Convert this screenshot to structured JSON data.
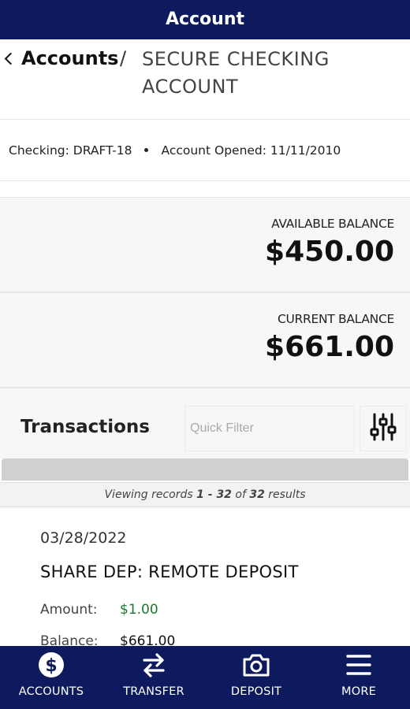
{
  "header": {
    "title": "Account"
  },
  "breadcrumb": {
    "back_label": "Accounts",
    "separator": "/",
    "current": "SECURE CHECKING ACCOUNT"
  },
  "account_info": {
    "checking": "Checking: DRAFT-18",
    "opened": "Account Opened: 11/11/2010"
  },
  "balances": {
    "available_label": "AVAILABLE BALANCE",
    "available_value": "$450.00",
    "current_label": "CURRENT BALANCE",
    "current_value": "$661.00"
  },
  "transactions": {
    "title": "Transactions",
    "filter_placeholder": "Quick Filter",
    "records": {
      "prefix": "Viewing records",
      "range": "1 - 32",
      "of": "of",
      "total": "32",
      "suffix": "results"
    },
    "items": [
      {
        "date": "03/28/2022",
        "description": "SHARE DEP: REMOTE DEPOSIT",
        "amount_label": "Amount:",
        "amount": "$1.00",
        "balance_label": "Balance:",
        "balance": "$661.00"
      }
    ]
  },
  "nav": [
    {
      "label": "ACCOUNTS",
      "icon": "dollar-circle-icon"
    },
    {
      "label": "TRANSFER",
      "icon": "transfer-arrows-icon"
    },
    {
      "label": "DEPOSIT",
      "icon": "camera-icon"
    },
    {
      "label": "MORE",
      "icon": "hamburger-menu-icon"
    }
  ],
  "colors": {
    "brand_navy": "#0d1b5e",
    "amount_green": "#1a7a2c"
  }
}
